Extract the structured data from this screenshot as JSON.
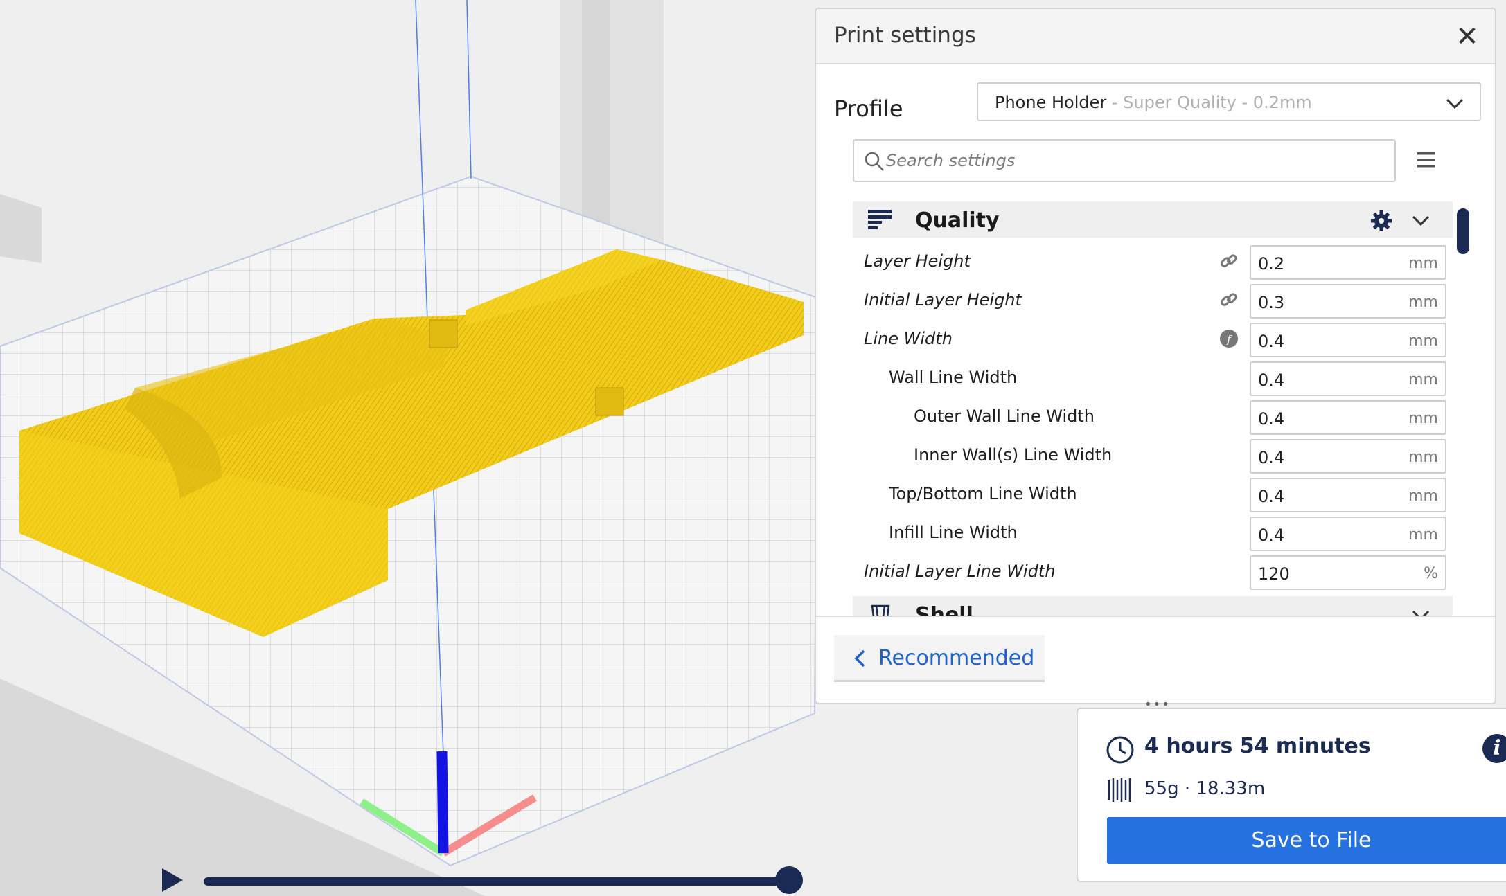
{
  "panel": {
    "title": "Print settings",
    "close_icon": "close-icon"
  },
  "profile": {
    "label": "Profile",
    "name": "Phone Holder",
    "separator": " - ",
    "quality": "Super Quality - 0.2mm"
  },
  "search": {
    "placeholder": "Search settings",
    "value": ""
  },
  "categories": [
    {
      "title": "Quality",
      "icon": "quality-icon"
    },
    {
      "title": "Shell",
      "icon": "shell-icon"
    }
  ],
  "settings": [
    {
      "label": "Layer Height",
      "value": "0.2",
      "unit": "mm",
      "icon": "link-icon"
    },
    {
      "label": "Initial Layer Height",
      "value": "0.3",
      "unit": "mm",
      "icon": "link-icon"
    },
    {
      "label": "Line Width",
      "value": "0.4",
      "unit": "mm",
      "icon": "function-icon"
    },
    {
      "label": "Wall Line Width",
      "value": "0.4",
      "unit": "mm"
    },
    {
      "label": "Outer Wall Line Width",
      "value": "0.4",
      "unit": "mm"
    },
    {
      "label": "Inner Wall(s) Line Width",
      "value": "0.4",
      "unit": "mm"
    },
    {
      "label": "Top/Bottom Line Width",
      "value": "0.4",
      "unit": "mm"
    },
    {
      "label": "Infill Line Width",
      "value": "0.4",
      "unit": "mm"
    },
    {
      "label": "Initial Layer Line Width",
      "value": "120",
      "unit": "%"
    }
  ],
  "footer": {
    "recommended_label": "Recommended",
    "drag_handle": "•••"
  },
  "print_info": {
    "time": "4 hours 54 minutes",
    "material": "55g · 18.33m",
    "save_label": "Save to File",
    "info_icon_glyph": "i"
  },
  "colors": {
    "accent": "#2671e0",
    "navy": "#1b2a52",
    "model": "#f5d018"
  }
}
